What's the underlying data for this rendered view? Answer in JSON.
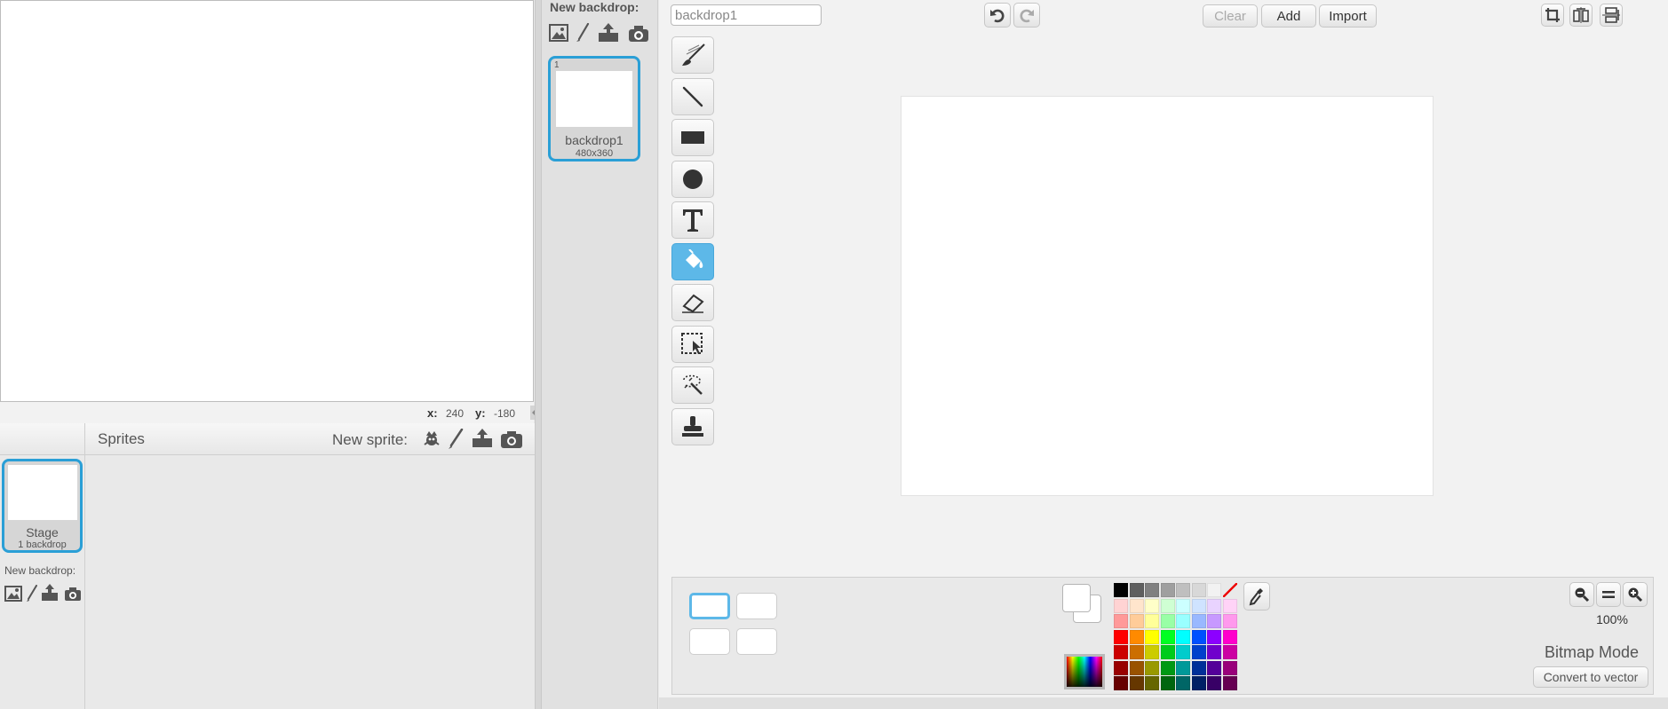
{
  "stage": {
    "coords": {
      "x_label": "x:",
      "x_value": "240",
      "y_label": "y:",
      "y_value": "-180"
    }
  },
  "sprites_pane": {
    "title": "Sprites",
    "new_sprite_label": "New sprite:",
    "new_sprite_icons": [
      "sprite-library-icon",
      "paint-brush-icon",
      "upload-icon",
      "camera-icon"
    ],
    "stage_thumb": {
      "name": "Stage",
      "subtitle": "1 backdrop"
    },
    "stage_new_backdrop_label": "New backdrop:"
  },
  "backdrops": {
    "new_backdrop_label": "New backdrop:",
    "items": [
      {
        "index": "1",
        "name": "backdrop1",
        "size": "480x360"
      }
    ]
  },
  "editor": {
    "name_field_value": "backdrop1",
    "buttons": {
      "clear": "Clear",
      "add": "Add",
      "import": "Import"
    },
    "tools": [
      "brush",
      "line",
      "rectangle",
      "ellipse",
      "text",
      "fill",
      "eraser",
      "select",
      "remove-background",
      "stamp"
    ],
    "active_tool": "fill",
    "zoom": "100%",
    "mode": "Bitmap Mode",
    "convert_button": "Convert to vector",
    "palette": [
      [
        "#000000",
        "#5f5f5f",
        "#808080",
        "#9f9f9f",
        "#bfbfbf",
        "#d8d8d8",
        "#f2f2f2",
        "none"
      ],
      [
        "#ffd3d3",
        "#ffe5cc",
        "#ffffc8",
        "#cfffd3",
        "#ccffff",
        "#cfe3ff",
        "#e9d3ff",
        "#ffd3f7"
      ],
      [
        "#ff9999",
        "#ffcc99",
        "#ffff99",
        "#99ffa6",
        "#99ffff",
        "#99b8ff",
        "#c799ff",
        "#ff99ed"
      ],
      [
        "#ff0000",
        "#ff8a00",
        "#ffff00",
        "#00ff22",
        "#00ffff",
        "#0050ff",
        "#8c00ff",
        "#ff00cc"
      ],
      [
        "#cc0000",
        "#cc6e00",
        "#cccc00",
        "#00cc1b",
        "#00cccc",
        "#0040cc",
        "#7000cc",
        "#cc00a3"
      ],
      [
        "#990000",
        "#995200",
        "#999900",
        "#009914",
        "#009999",
        "#003099",
        "#540099",
        "#99007a"
      ],
      [
        "#660000",
        "#663700",
        "#666600",
        "#00660e",
        "#006666",
        "#002066",
        "#380066",
        "#660052"
      ]
    ]
  }
}
